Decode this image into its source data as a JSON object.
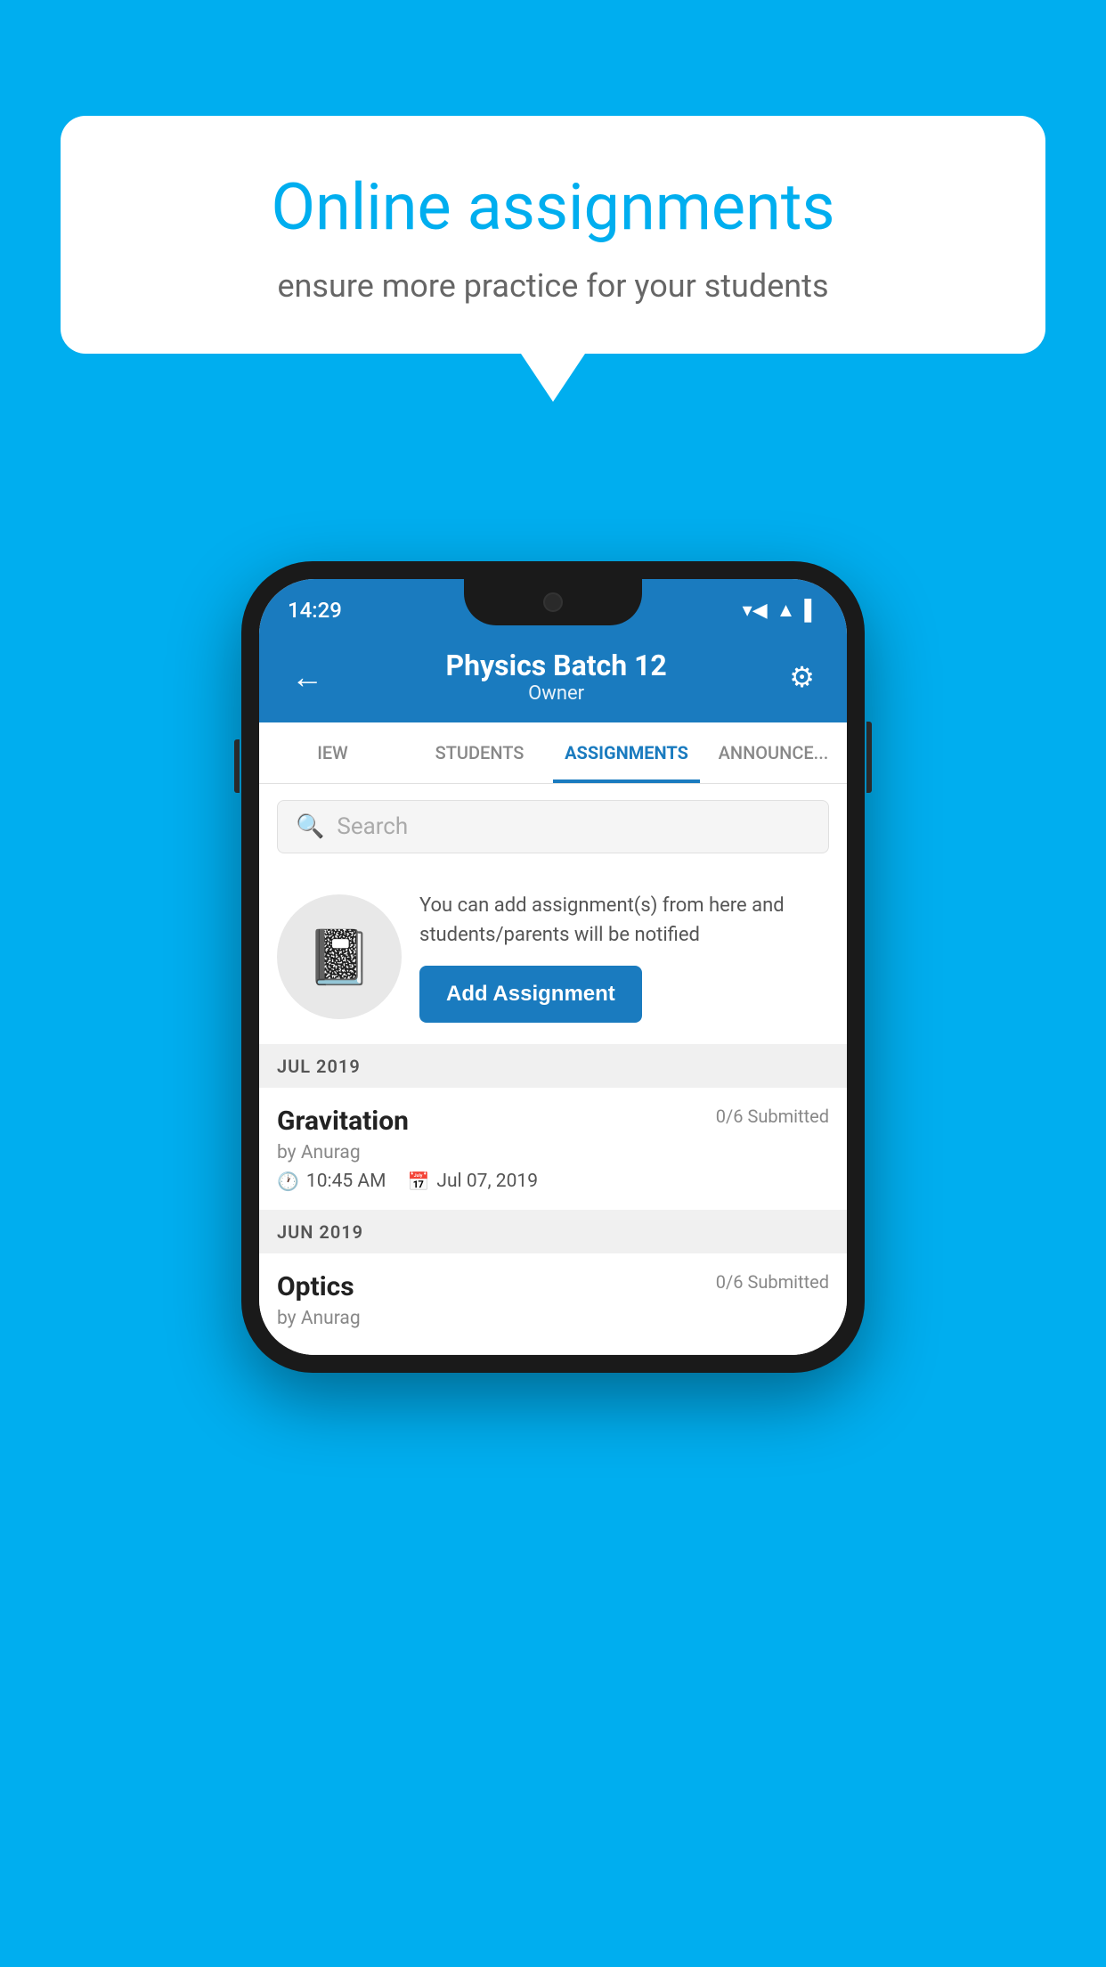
{
  "background_color": "#00AEEF",
  "speech_bubble": {
    "title": "Online assignments",
    "subtitle": "ensure more practice for your students"
  },
  "phone": {
    "status_bar": {
      "time": "14:29",
      "icons": [
        "wifi",
        "signal",
        "battery"
      ]
    },
    "header": {
      "title": "Physics Batch 12",
      "subtitle": "Owner",
      "back_label": "←",
      "settings_label": "⚙"
    },
    "tabs": [
      {
        "label": "IEW",
        "active": false
      },
      {
        "label": "STUDENTS",
        "active": false
      },
      {
        "label": "ASSIGNMENTS",
        "active": true
      },
      {
        "label": "ANNOUNCEMENTS",
        "active": false
      }
    ],
    "search": {
      "placeholder": "Search"
    },
    "promo": {
      "text": "You can add assignment(s) from here and students/parents will be notified",
      "button_label": "Add Assignment"
    },
    "sections": [
      {
        "month": "JUL 2019",
        "assignments": [
          {
            "name": "Gravitation",
            "submitted": "0/6 Submitted",
            "by": "by Anurag",
            "time": "10:45 AM",
            "date": "Jul 07, 2019"
          }
        ]
      },
      {
        "month": "JUN 2019",
        "assignments": [
          {
            "name": "Optics",
            "submitted": "0/6 Submitted",
            "by": "by Anurag",
            "time": "",
            "date": ""
          }
        ]
      }
    ]
  }
}
